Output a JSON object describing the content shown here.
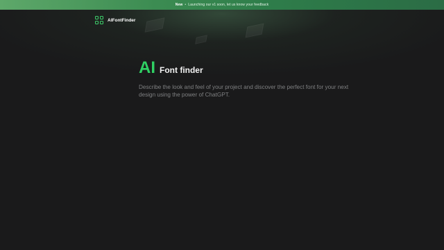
{
  "banner": {
    "badge": "New",
    "separator": "•",
    "message": "Launching our v1 soon, let us know your feedback"
  },
  "header": {
    "logo_icon": "four-squares-icon",
    "brand_name": "AIFontFinder"
  },
  "hero": {
    "title_highlight": "AI",
    "title_rest": "Font finder",
    "description": "Describe the look and feel of your project and discover the perfect font for your next design using the power of ChatGPT."
  },
  "colors": {
    "background": "#1a1a1b",
    "accent": "#2fd063",
    "banner_start": "#5ea86a",
    "banner_end": "#2b6c45"
  }
}
